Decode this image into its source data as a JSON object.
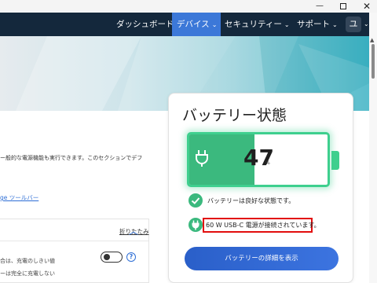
{
  "window": {
    "minimize_glyph": "—",
    "close_glyph": "✕"
  },
  "nav": {
    "items": [
      {
        "label": "ダッシュボード"
      },
      {
        "label": "デバイス",
        "active": true
      },
      {
        "label": "セキュリティー"
      },
      {
        "label": "サポート"
      }
    ],
    "chevron": "⌄",
    "user_initial": "ユ",
    "active_color": "#3c78d8",
    "bar_color": "#14283c"
  },
  "left": {
    "description_line1": "ー般的な電源機能も実行できます。このセクションでデフ",
    "edge_link": "ge ツールバー",
    "collapse_label": "折りたたみ",
    "collapse_chevron": "︿",
    "help_glyph": "?",
    "sub_line1": "合は、充電のしきい値",
    "sub_line2": "ーは完全に充電しない"
  },
  "battery": {
    "title": "バッテリー状態",
    "percent": 47,
    "percent_text": "47",
    "unit": "%",
    "status_text": "バッテリーは良好な状態です。",
    "power_text": "60 W USB-C 電源が接続されています。",
    "details_button": "バッテリーの詳細を表示",
    "accent_color": "#3ecf8e",
    "fill_color": "#3bb97e",
    "highlight_color": "#e20d0d"
  }
}
